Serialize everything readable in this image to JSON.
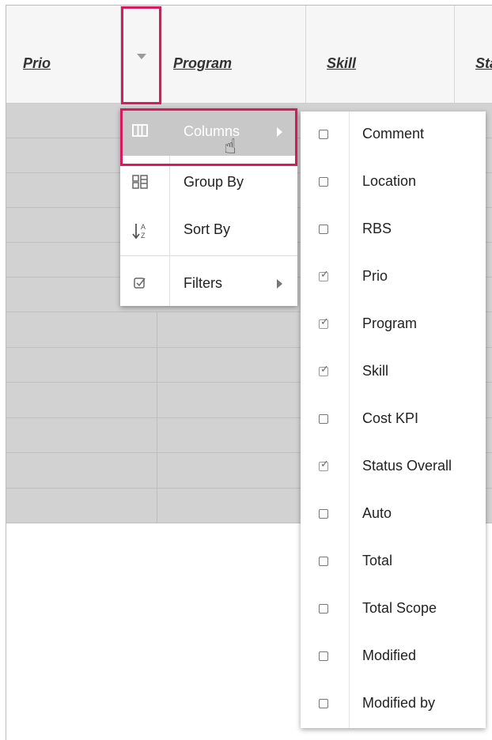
{
  "header": {
    "columns": [
      {
        "label": "Prio"
      },
      {
        "label": "Program"
      },
      {
        "label": "Skill"
      },
      {
        "label": "Sta"
      }
    ],
    "arrow_icon": "chevron-down-icon"
  },
  "menu": {
    "items": [
      {
        "label": "Columns",
        "icon": "columns-icon",
        "highlighted": true,
        "has_submenu": true
      },
      {
        "label": "Group By",
        "icon": "group-by-icon"
      },
      {
        "label": "Sort By",
        "icon": "sort-az-icon"
      },
      {
        "label": "Filters",
        "icon": "checkbox-icon",
        "has_submenu": true
      }
    ]
  },
  "columns_submenu": {
    "items": [
      {
        "label": "Comment",
        "checked": false
      },
      {
        "label": "Location",
        "checked": false
      },
      {
        "label": "RBS",
        "checked": false
      },
      {
        "label": "Prio",
        "checked": true
      },
      {
        "label": "Program",
        "checked": true
      },
      {
        "label": "Skill",
        "checked": true
      },
      {
        "label": "Cost KPI",
        "checked": false
      },
      {
        "label": "Status Overall",
        "checked": true
      },
      {
        "label": "Auto",
        "checked": false
      },
      {
        "label": "Total",
        "checked": false
      },
      {
        "label": "Total Scope",
        "checked": false
      },
      {
        "label": "Modified",
        "checked": false
      },
      {
        "label": "Modified by",
        "checked": false
      }
    ]
  },
  "colors": {
    "highlight_border": "#d81b5e",
    "menu_highlight": "#c8c8c8",
    "row_fill": "#d2d2d2"
  }
}
